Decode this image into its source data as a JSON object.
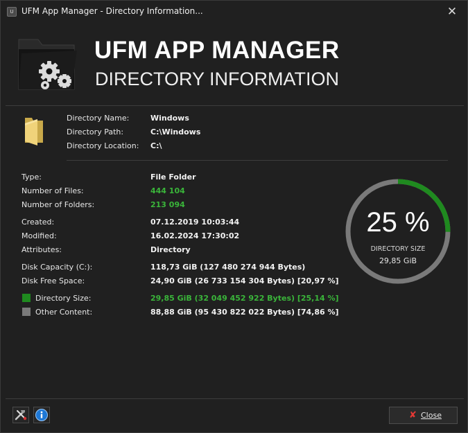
{
  "window": {
    "title": "UFM App Manager - Directory Information...",
    "title_icon": "app-logo-icon",
    "close_glyph": "✕"
  },
  "header": {
    "app_name": "UFM APP MANAGER",
    "subtitle": "DIRECTORY INFORMATION",
    "icon": "folder-gears-icon"
  },
  "directory": {
    "icon": "folder-icon",
    "name_label": "Directory Name:",
    "name": "Windows",
    "path_label": "Directory Path:",
    "path": "C:\\Windows",
    "location_label": "Directory Location:",
    "location": "C:\\"
  },
  "details": {
    "type_label": "Type:",
    "type": "File Folder",
    "files_label": "Number of Files:",
    "files": "444 104",
    "folders_label": "Number of Folders:",
    "folders": "213 094",
    "created_label": "Created:",
    "created": "07.12.2019 10:03:44",
    "modified_label": "Modified:",
    "modified": "16.02.2024 17:30:02",
    "attributes_label": "Attributes:",
    "attributes": "Directory",
    "capacity_label": "Disk Capacity (C:):",
    "capacity": "118,73 GiB (127 480 274 944 Bytes)",
    "free_label": "Disk Free Space:",
    "free": "24,90 GiB (26 733 154 304 Bytes) [20,97 %]",
    "dirsize_label": "Directory Size:",
    "dirsize": "29,85 GiB (32 049 452 922 Bytes) [25,14 %]",
    "other_label": "Other Content:",
    "other": "88,88 GiB (95 430 822 022 Bytes) [74,86 %]"
  },
  "gauge": {
    "percent_text": "25 %",
    "fraction": 0.2514,
    "caption": "DIRECTORY SIZE",
    "size": "29,85 GiB"
  },
  "colors": {
    "directory_size": "#1f8a1f",
    "other_content": "#7a7a7a",
    "value_green": "#3ab53a",
    "close_icon_red": "#e53935"
  },
  "footer": {
    "tools_icon": "tools-icon",
    "info_icon": "info-icon",
    "close_label": "Close",
    "close_icon": "close-x-icon"
  }
}
